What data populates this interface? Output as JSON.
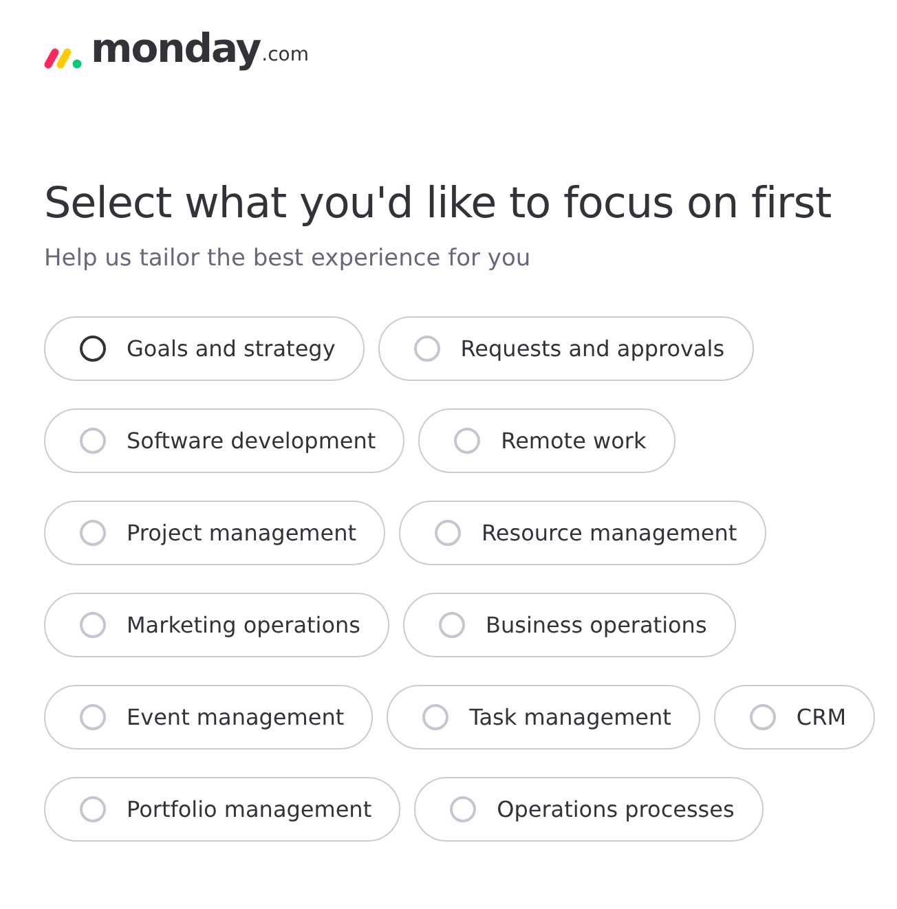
{
  "logo": {
    "wordmark": "monday",
    "suffix": ".com"
  },
  "heading": "Select what you'd like to focus on first",
  "subheading": "Help us tailor the best experience for you",
  "option_rows": [
    [
      {
        "label": "Goals and strategy",
        "selected": false,
        "hovered": true
      },
      {
        "label": "Requests and approvals",
        "selected": false,
        "hovered": false
      }
    ],
    [
      {
        "label": "Software development",
        "selected": false,
        "hovered": false
      },
      {
        "label": "Remote work",
        "selected": false,
        "hovered": false
      }
    ],
    [
      {
        "label": "Project management",
        "selected": false,
        "hovered": false
      },
      {
        "label": "Resource management",
        "selected": false,
        "hovered": false
      }
    ],
    [
      {
        "label": "Marketing operations",
        "selected": false,
        "hovered": false
      },
      {
        "label": "Business operations",
        "selected": false,
        "hovered": false
      }
    ],
    [
      {
        "label": "Event management",
        "selected": false,
        "hovered": false
      },
      {
        "label": "Task management",
        "selected": false,
        "hovered": false
      },
      {
        "label": "CRM",
        "selected": false,
        "hovered": false
      }
    ],
    [
      {
        "label": "Portfolio management",
        "selected": false,
        "hovered": false
      },
      {
        "label": "Operations processes",
        "selected": false,
        "hovered": false
      }
    ]
  ]
}
